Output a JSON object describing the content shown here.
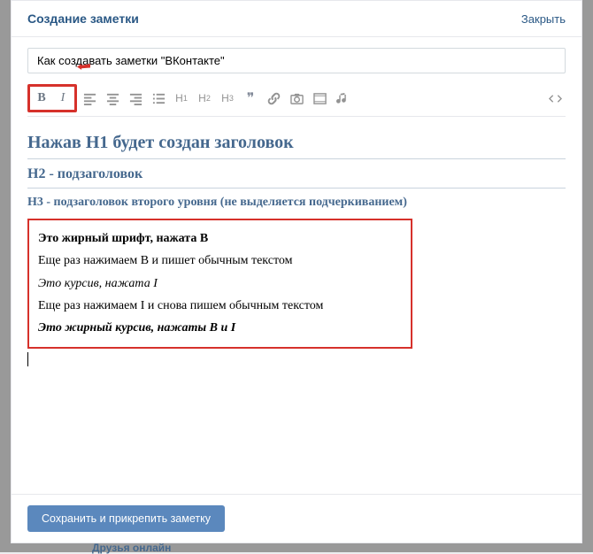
{
  "header": {
    "title": "Создание заметки",
    "close": "Закрыть"
  },
  "note_title": "Как создавать заметки \"ВКонтакте\"",
  "toolbar": {
    "bold": "B",
    "italic": "I",
    "h1": "H",
    "h1s": "1",
    "h2": "H",
    "h2s": "2",
    "h3": "H",
    "h3s": "3",
    "quote": "❞"
  },
  "content": {
    "h1": "Нажав Н1 будет создан заголовок",
    "h2": "Н2 - подзаголовок",
    "h3": "Н3 - подзаголовок второго уровня (не выделяется подчеркиванием)",
    "box": {
      "line1": "Это жирный шрифт, нажата В",
      "line2": "Еще раз нажимаем В и пишет обычным текстом",
      "line3": "Это курсив, нажата I",
      "line4": "Еще раз нажимаем I и снова пишем обычным текстом",
      "line5": "Это жирный курсив, нажаты В и I"
    }
  },
  "footer": {
    "save": "Сохранить и прикрепить заметку"
  },
  "background": {
    "friends_online": "Друзья онлайн"
  }
}
